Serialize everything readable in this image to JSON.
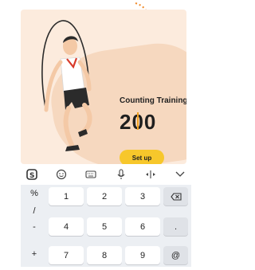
{
  "card": {
    "title": "Counting Training",
    "count": "200",
    "setup_label": "Set up"
  },
  "toolbar": {
    "icons": [
      "sogou-logo-icon",
      "emoji-icon",
      "keyboard-icon",
      "mic-icon",
      "cursor-move-icon",
      "chevron-down-icon"
    ]
  },
  "keyboard": {
    "left_column": [
      "%",
      "/",
      "-",
      "+"
    ],
    "rows": [
      [
        "1",
        "2",
        "3"
      ],
      [
        "4",
        "5",
        "6"
      ],
      [
        "7",
        "8",
        "9"
      ]
    ],
    "right_column": [
      "⌫",
      ".",
      "@"
    ]
  },
  "colors": {
    "card_bg": "#fcebdd",
    "accent": "#f7c72b",
    "cursor": "#f0a020",
    "arrow": "#f08a2a"
  }
}
